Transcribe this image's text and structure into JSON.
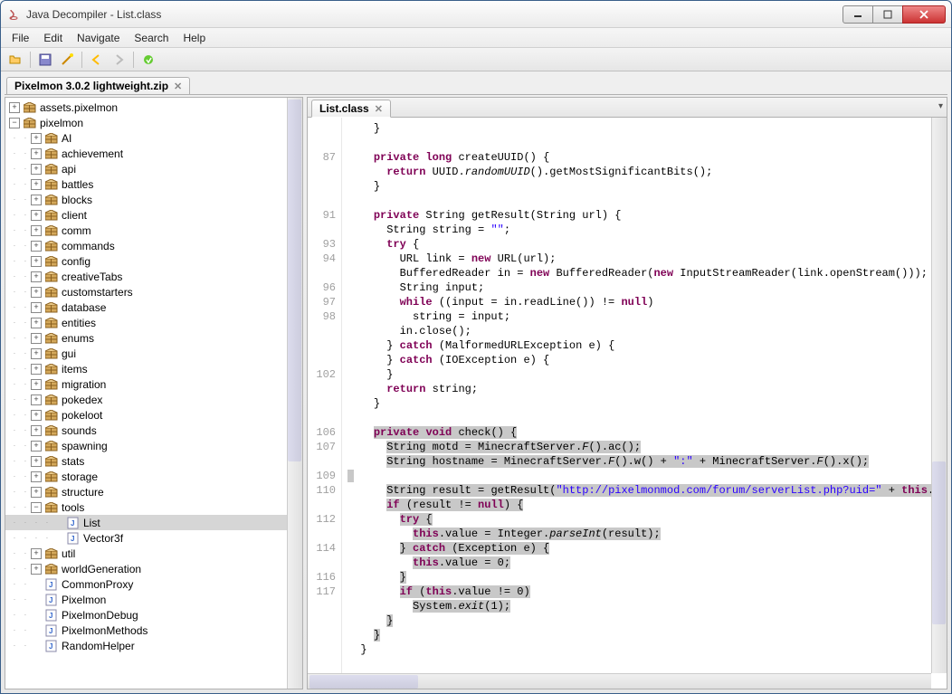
{
  "window": {
    "title": "Java Decompiler - List.class"
  },
  "menu": {
    "file": "File",
    "edit": "Edit",
    "navigate": "Navigate",
    "search": "Search",
    "help": "Help"
  },
  "topTab": {
    "label": "Pixelmon 3.0.2 lightweight.zip"
  },
  "tree": {
    "assets": "assets.pixelmon",
    "pixelmon": "pixelmon",
    "items": [
      "AI",
      "achievement",
      "api",
      "battles",
      "blocks",
      "client",
      "comm",
      "commands",
      "config",
      "creativeTabs",
      "customstarters",
      "database",
      "entities",
      "enums",
      "gui",
      "items",
      "migration",
      "pokedex",
      "pokeloot",
      "sounds",
      "spawning",
      "stats",
      "storage",
      "structure"
    ],
    "tools": "tools",
    "toolsChildren": [
      "List",
      "Vector3f"
    ],
    "util": "util",
    "worldGen": "worldGeneration",
    "classes": [
      "CommonProxy",
      "Pixelmon",
      "PixelmonDebug",
      "PixelmonMethods",
      "RandomHelper"
    ]
  },
  "editor": {
    "tabLabel": "List.class",
    "lineNumbers": [
      "",
      "",
      "87",
      "",
      "",
      "",
      "91",
      "",
      "93",
      "94",
      "",
      "96",
      "97",
      "98",
      "",
      "",
      "",
      "102",
      "",
      "",
      "",
      "106",
      "107",
      "",
      "109",
      "110",
      "",
      "112",
      "",
      "114",
      "",
      "116",
      "117",
      "",
      "",
      "",
      ""
    ],
    "code": [
      {
        "indent": "    ",
        "segs": [
          {
            "t": "}"
          }
        ]
      },
      {
        "indent": "",
        "segs": [
          {
            "t": " "
          }
        ]
      },
      {
        "indent": "    ",
        "segs": [
          {
            "t": "private",
            "c": "kw"
          },
          {
            "t": " "
          },
          {
            "t": "long",
            "c": "kw"
          },
          {
            "t": " createUUID() {"
          }
        ]
      },
      {
        "indent": "      ",
        "segs": [
          {
            "t": "return",
            "c": "kw"
          },
          {
            "t": " UUID."
          },
          {
            "t": "randomUUID",
            "c": "italic"
          },
          {
            "t": "().getMostSignificantBits();"
          }
        ]
      },
      {
        "indent": "    ",
        "segs": [
          {
            "t": "}"
          }
        ]
      },
      {
        "indent": "",
        "segs": [
          {
            "t": " "
          }
        ]
      },
      {
        "indent": "    ",
        "segs": [
          {
            "t": "private",
            "c": "kw"
          },
          {
            "t": " String getResult(String url) {"
          }
        ]
      },
      {
        "indent": "      ",
        "segs": [
          {
            "t": "String string = "
          },
          {
            "t": "\"\"",
            "c": "str"
          },
          {
            "t": ";"
          }
        ]
      },
      {
        "indent": "      ",
        "segs": [
          {
            "t": "try",
            "c": "kw"
          },
          {
            "t": " {"
          }
        ]
      },
      {
        "indent": "        ",
        "segs": [
          {
            "t": "URL link = "
          },
          {
            "t": "new",
            "c": "kw"
          },
          {
            "t": " URL(url);"
          }
        ]
      },
      {
        "indent": "        ",
        "segs": [
          {
            "t": "BufferedReader in = "
          },
          {
            "t": "new",
            "c": "kw"
          },
          {
            "t": " BufferedReader("
          },
          {
            "t": "new",
            "c": "kw"
          },
          {
            "t": " InputStreamReader(link.openStream()));"
          }
        ]
      },
      {
        "indent": "        ",
        "segs": [
          {
            "t": "String input;"
          }
        ]
      },
      {
        "indent": "        ",
        "segs": [
          {
            "t": "while",
            "c": "kw"
          },
          {
            "t": " ((input = in.readLine()) != "
          },
          {
            "t": "null",
            "c": "kw"
          },
          {
            "t": ")"
          }
        ]
      },
      {
        "indent": "          ",
        "segs": [
          {
            "t": "string = input;"
          }
        ]
      },
      {
        "indent": "        ",
        "segs": [
          {
            "t": "in.close();"
          }
        ]
      },
      {
        "indent": "      ",
        "segs": [
          {
            "t": "} "
          },
          {
            "t": "catch",
            "c": "kw"
          },
          {
            "t": " (MalformedURLException e) {"
          }
        ]
      },
      {
        "indent": "      ",
        "segs": [
          {
            "t": "} "
          },
          {
            "t": "catch",
            "c": "kw"
          },
          {
            "t": " (IOException e) {"
          }
        ]
      },
      {
        "indent": "      ",
        "segs": [
          {
            "t": "}"
          }
        ]
      },
      {
        "indent": "      ",
        "segs": [
          {
            "t": "return",
            "c": "kw"
          },
          {
            "t": " string;"
          }
        ]
      },
      {
        "indent": "    ",
        "segs": [
          {
            "t": "}"
          }
        ]
      },
      {
        "indent": "",
        "segs": [
          {
            "t": " "
          }
        ]
      },
      {
        "indent": "    ",
        "sel": true,
        "segs": [
          {
            "t": "private",
            "c": "kw"
          },
          {
            "t": " "
          },
          {
            "t": "void",
            "c": "kw"
          },
          {
            "t": " check() {"
          }
        ]
      },
      {
        "indent": "      ",
        "sel": true,
        "segs": [
          {
            "t": "String motd = MinecraftServer."
          },
          {
            "t": "F",
            "c": "italic"
          },
          {
            "t": "().ac();"
          }
        ]
      },
      {
        "indent": "      ",
        "sel": true,
        "segs": [
          {
            "t": "String hostname = MinecraftServer."
          },
          {
            "t": "F",
            "c": "italic"
          },
          {
            "t": "().w() + "
          },
          {
            "t": "\":\"",
            "c": "str"
          },
          {
            "t": " + MinecraftServer."
          },
          {
            "t": "F",
            "c": "italic"
          },
          {
            "t": "().x();"
          }
        ]
      },
      {
        "indent": "",
        "sel": true,
        "segs": [
          {
            "t": " "
          }
        ]
      },
      {
        "indent": "      ",
        "sel": true,
        "segs": [
          {
            "t": "String result = getResult("
          },
          {
            "t": "\"http://pixelmonmod.com/forum/serverList.php?uid=\"",
            "c": "str"
          },
          {
            "t": " + "
          },
          {
            "t": "this",
            "c": "kw"
          },
          {
            "t": ".uuid);"
          }
        ]
      },
      {
        "indent": "      ",
        "sel": true,
        "segs": [
          {
            "t": "if",
            "c": "kw"
          },
          {
            "t": " (result != "
          },
          {
            "t": "null",
            "c": "kw"
          },
          {
            "t": ") {"
          }
        ]
      },
      {
        "indent": "        ",
        "sel": true,
        "segs": [
          {
            "t": "try",
            "c": "kw"
          },
          {
            "t": " {"
          }
        ]
      },
      {
        "indent": "          ",
        "sel": true,
        "segs": [
          {
            "t": "this",
            "c": "kw"
          },
          {
            "t": ".value = Integer."
          },
          {
            "t": "parseInt",
            "c": "italic"
          },
          {
            "t": "(result);"
          }
        ]
      },
      {
        "indent": "        ",
        "sel": true,
        "segs": [
          {
            "t": "} "
          },
          {
            "t": "catch",
            "c": "kw"
          },
          {
            "t": " (Exception e) {"
          }
        ]
      },
      {
        "indent": "          ",
        "sel": true,
        "segs": [
          {
            "t": "this",
            "c": "kw"
          },
          {
            "t": ".value = 0;"
          }
        ]
      },
      {
        "indent": "        ",
        "sel": true,
        "segs": [
          {
            "t": "}"
          }
        ]
      },
      {
        "indent": "        ",
        "sel": true,
        "segs": [
          {
            "t": "if",
            "c": "kw"
          },
          {
            "t": " ("
          },
          {
            "t": "this",
            "c": "kw"
          },
          {
            "t": ".value != 0)"
          }
        ]
      },
      {
        "indent": "          ",
        "sel": true,
        "segs": [
          {
            "t": "System."
          },
          {
            "t": "exit",
            "c": "italic"
          },
          {
            "t": "(1);"
          }
        ]
      },
      {
        "indent": "      ",
        "sel": true,
        "segs": [
          {
            "t": "}"
          }
        ]
      },
      {
        "indent": "    ",
        "sel": true,
        "segs": [
          {
            "t": "}"
          }
        ]
      },
      {
        "indent": "  ",
        "segs": [
          {
            "t": "}"
          }
        ]
      }
    ]
  }
}
